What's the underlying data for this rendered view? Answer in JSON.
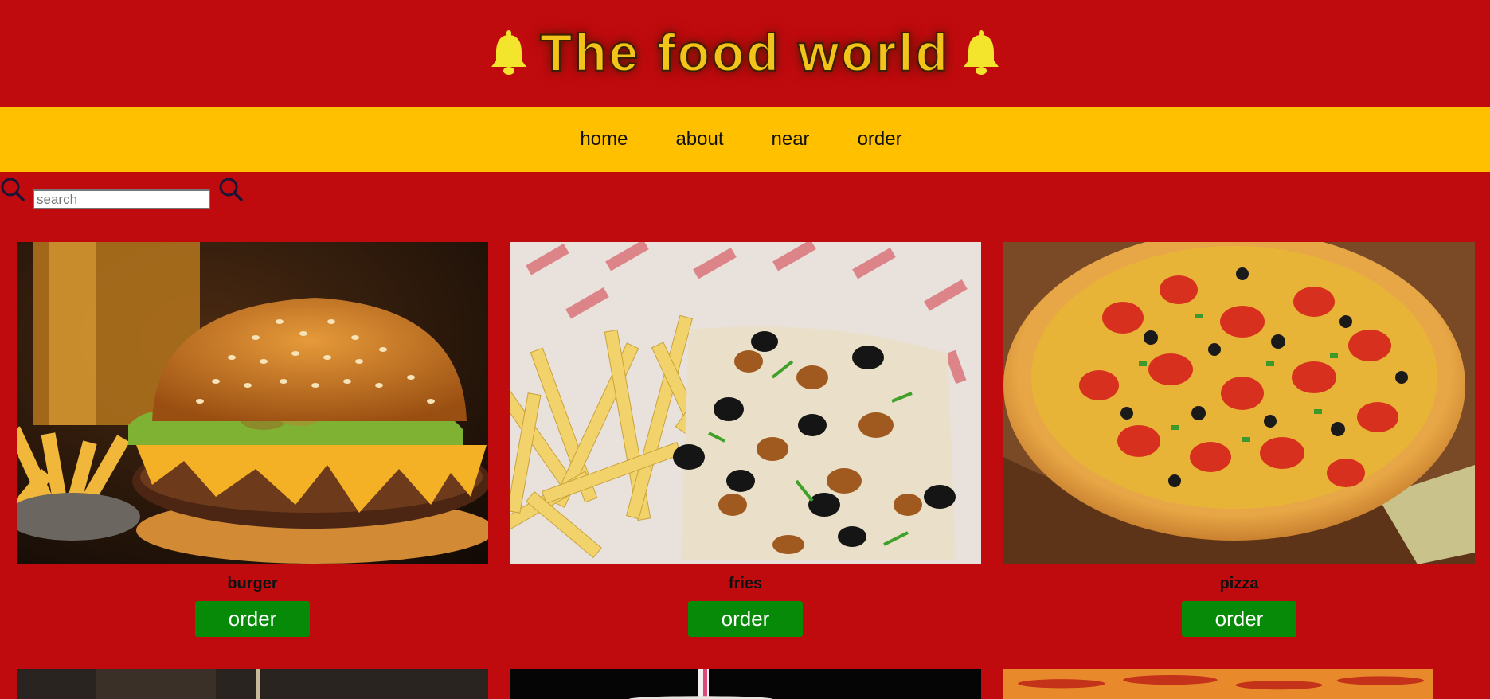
{
  "header": {
    "title": "The food world",
    "left_icon": "bell-icon",
    "right_icon": "bell-icon"
  },
  "nav": {
    "items": [
      {
        "label": "home"
      },
      {
        "label": "about"
      },
      {
        "label": "near"
      },
      {
        "label": "order"
      }
    ]
  },
  "search": {
    "placeholder": "search",
    "value": "",
    "left_icon": "search-icon",
    "right_icon": "search-icon"
  },
  "menu": {
    "items": [
      {
        "name": "burger",
        "button": "order",
        "image": "burger-image"
      },
      {
        "name": "fries",
        "button": "order",
        "image": "fries-image"
      },
      {
        "name": "pizza",
        "button": "order",
        "image": "pizza-image"
      }
    ],
    "next_row_images": [
      "dark-food-image",
      "drink-image",
      "pepperoni-pizza-image"
    ]
  },
  "colors": {
    "page_background": "#c00b0e",
    "nav_background": "#ffc000",
    "title_color": "#f2c319",
    "order_button": "#078a07",
    "bell": "#f3e52b",
    "search_icon": "#1a1436"
  }
}
